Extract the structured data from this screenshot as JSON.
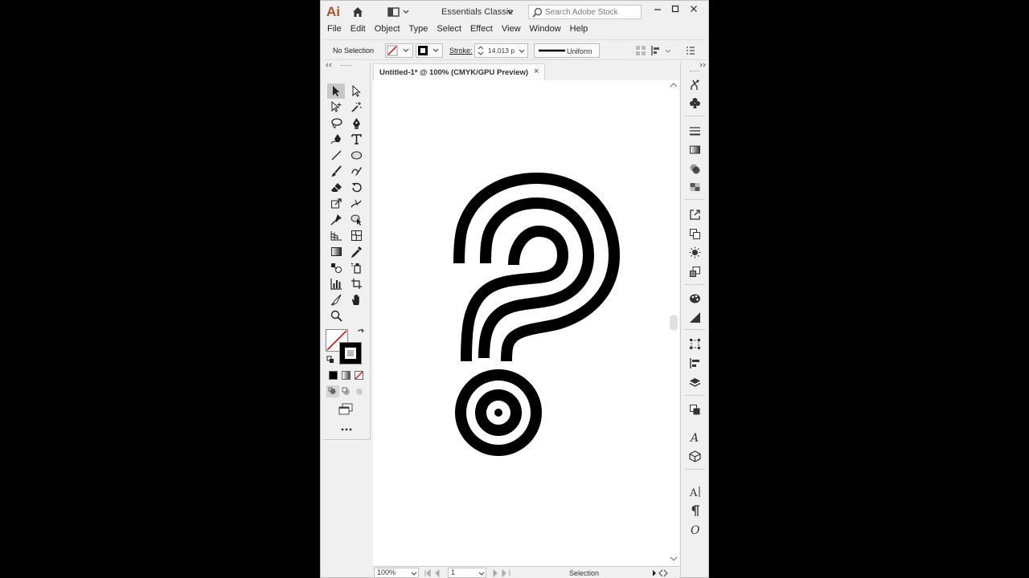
{
  "app": {
    "logo": "Ai",
    "workspace": "Essentials Classic",
    "search_placeholder": "Search Adobe Stock"
  },
  "menu": [
    "File",
    "Edit",
    "Object",
    "Type",
    "Select",
    "Effect",
    "View",
    "Window",
    "Help"
  ],
  "control_bar": {
    "selection": "No Selection",
    "stroke_label": "Stroke:",
    "stroke_value": "14.013 p",
    "profile": "Uniform"
  },
  "document": {
    "tab_title": "Untitled-1* @ 100% (CMYK/GPU Preview)",
    "close": "×"
  },
  "status": {
    "zoom": "100%",
    "page": "1",
    "tool": "Selection"
  },
  "colors": {
    "logo": "#b0512e",
    "artwork": "#000000",
    "canvas": "#ffffff",
    "chrome": "#f0f0f0"
  }
}
